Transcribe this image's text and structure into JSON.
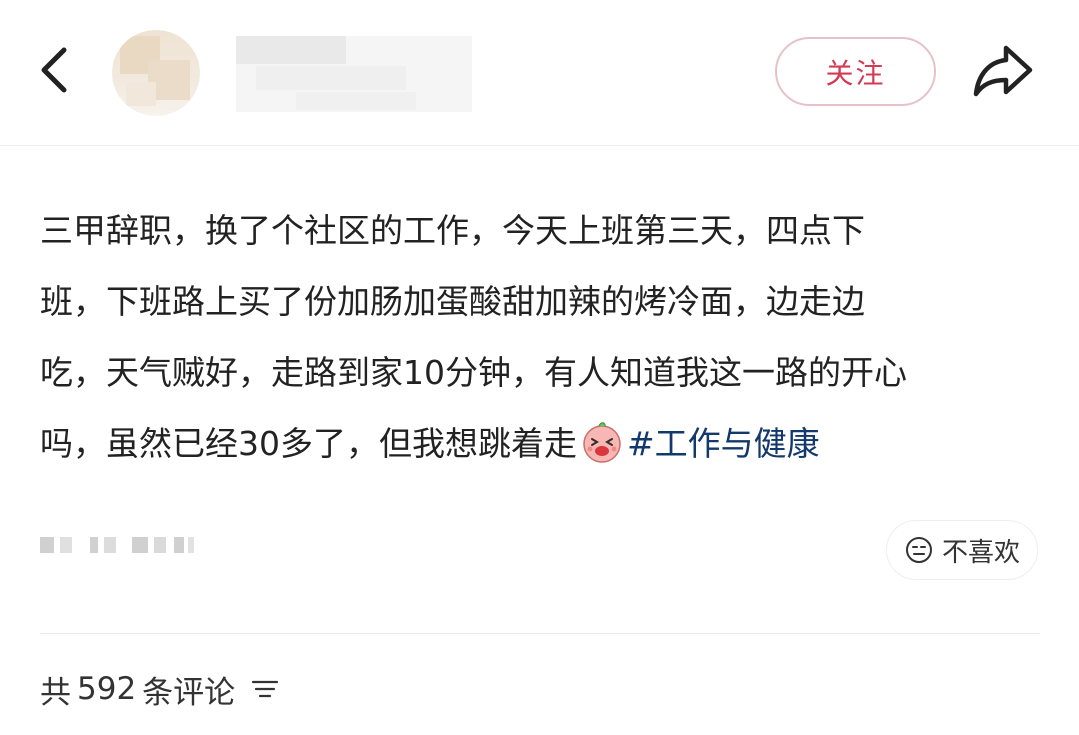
{
  "header": {
    "back_icon": "chevron-left-icon",
    "follow_label": "关注",
    "share_icon": "share-arrow-icon",
    "accent_color": "#d53a55"
  },
  "post": {
    "lines": [
      "三甲辞职，换了个社区的工作，今天上班第三天，四点下",
      "班，下班路上买了份加肠加蛋酸甜加辣的烤冷面，边走边",
      "吃，天气贼好，走路到家10分钟，有人知道我这一路的开心",
      "吗，虽然已经30多了，但我想跳着走"
    ],
    "emoji": "laughing-sticker-icon",
    "hashtag": "#工作与健康",
    "hashtag_color": "#13386c"
  },
  "actions": {
    "dislike_label": "不喜欢",
    "dislike_icon": "neutral-face-icon"
  },
  "comments": {
    "prefix": "共",
    "count": "592",
    "suffix": "条评论",
    "sort_icon": "sort-filter-icon"
  }
}
